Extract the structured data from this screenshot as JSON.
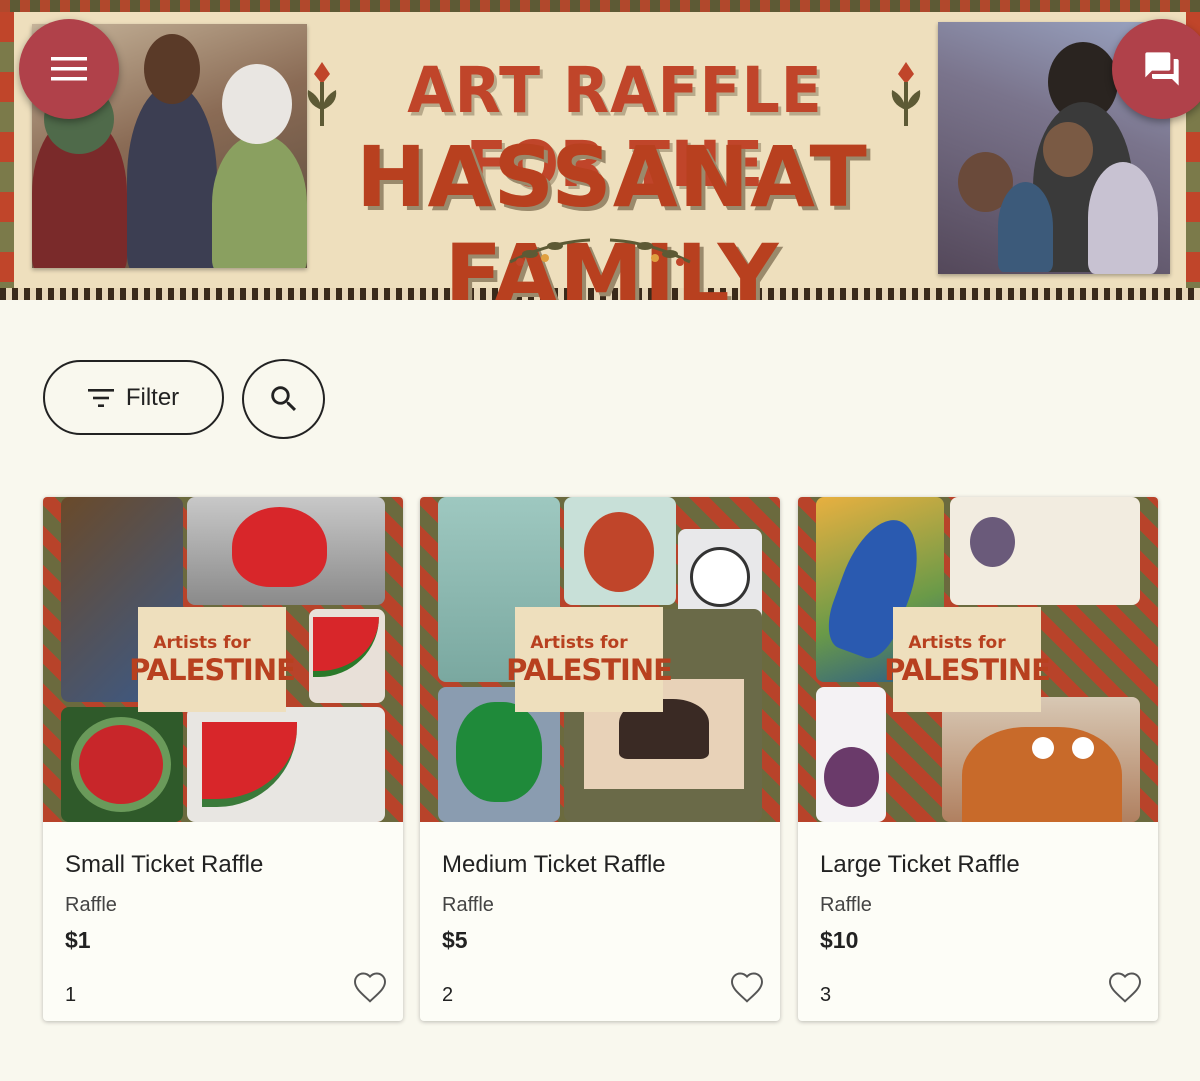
{
  "banner": {
    "title_line1": "ART RAFFLE FOR THE",
    "title_line2": "HASSANAT FAMILY"
  },
  "fabs": {
    "menu_icon": "menu-icon",
    "chat_icon": "forum-icon"
  },
  "toolbar": {
    "filter_label": "Filter",
    "filter_icon": "filter-list-icon",
    "search_icon": "search-icon"
  },
  "badge": {
    "line1": "Artists for",
    "line2": "PALESTINE"
  },
  "cards": [
    {
      "name": "Small Ticket Raffle",
      "type": "Raffle",
      "price": "$1",
      "number": "1"
    },
    {
      "name": "Medium Ticket Raffle",
      "type": "Raffle",
      "price": "$5",
      "number": "2"
    },
    {
      "name": "Large Ticket Raffle",
      "type": "Raffle",
      "price": "$10",
      "number": "3"
    }
  ],
  "colors": {
    "background": "#f9f8ee",
    "fab": "#b0414a",
    "title_red": "#c0452a",
    "olive": "#5d5a35",
    "cream": "#eedfbd"
  }
}
